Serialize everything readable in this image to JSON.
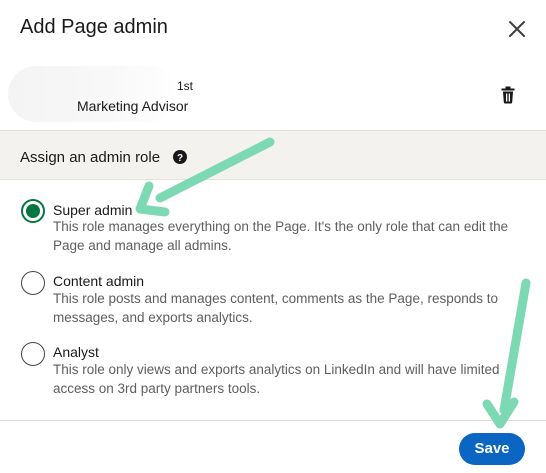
{
  "dialog": {
    "title": "Add Page admin",
    "close_icon": "close-icon"
  },
  "member": {
    "degree": "1st",
    "headline": "Marketing Advisor",
    "delete_icon": "trash-icon"
  },
  "section": {
    "label": "Assign an admin role",
    "help_icon": "question-circle-icon"
  },
  "roles": [
    {
      "name": "Super admin",
      "description": "This role manages everything on the Page. It's the only role that can edit the Page and manage all admins.",
      "selected": true
    },
    {
      "name": "Content admin",
      "description": "This role posts and manages content, comments as the Page, responds to messages, and exports analytics.",
      "selected": false
    },
    {
      "name": "Analyst",
      "description": "This role only views and exports analytics on LinkedIn and will have limited access on 3rd party partners tools.",
      "selected": false
    }
  ],
  "footer": {
    "save_label": "Save"
  },
  "colors": {
    "primary_button": "#0a66c2",
    "radio_selected": "#057642",
    "annotation_arrow": "#7dd9b4",
    "section_bg": "#f3f2ef"
  }
}
